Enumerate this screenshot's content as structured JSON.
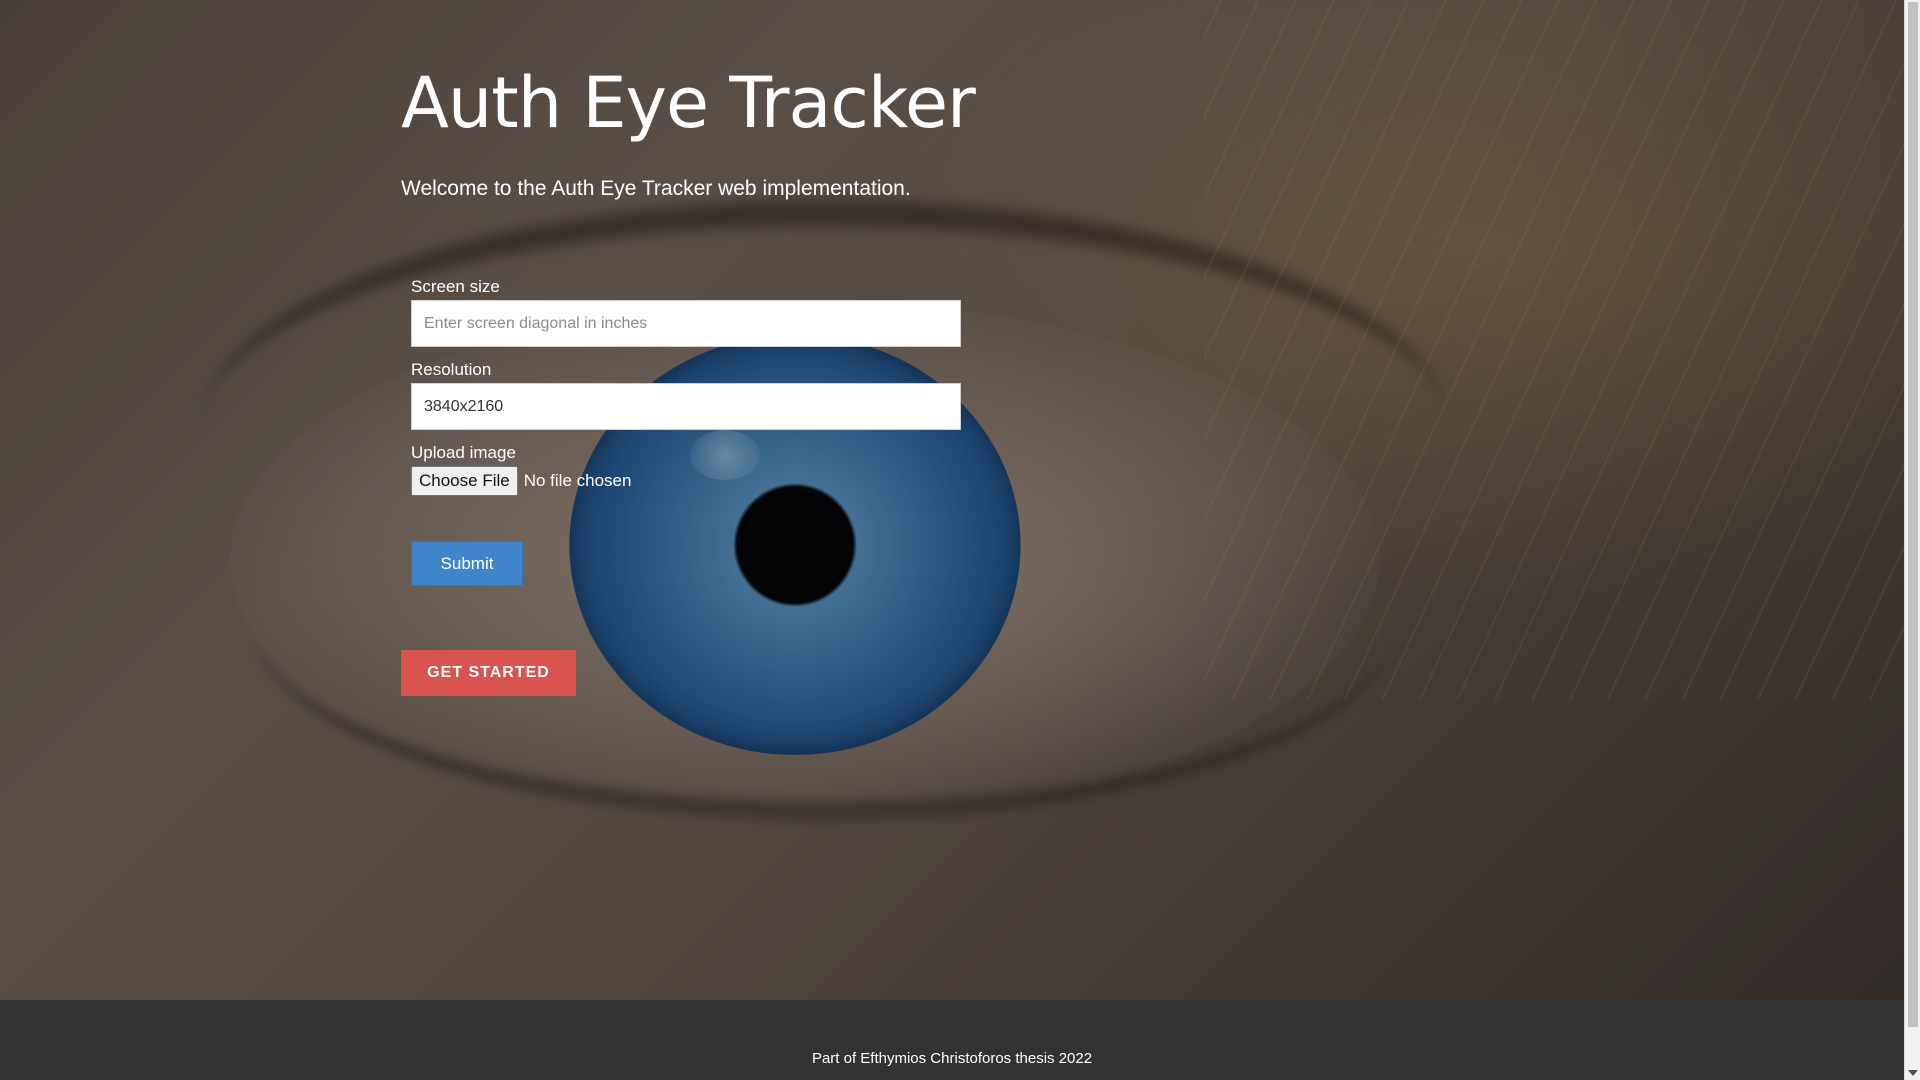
{
  "header": {
    "title": "Auth Eye Tracker",
    "subtitle": "Welcome to the Auth Eye Tracker web implementation."
  },
  "form": {
    "screen_size": {
      "label": "Screen size",
      "placeholder": "Enter screen diagonal in inches",
      "value": ""
    },
    "resolution": {
      "label": "Resolution",
      "value": "3840x2160"
    },
    "upload": {
      "label": "Upload image",
      "button_label": "Choose File",
      "status": "No file chosen"
    },
    "submit_label": "Submit"
  },
  "cta": {
    "get_started_label": "GET STARTED"
  },
  "footer": {
    "text": "Part of Efthymios Christoforos thesis 2022"
  },
  "colors": {
    "submit": "#3e85cc",
    "get_started": "#d9534f",
    "footer_bg": "#333333"
  },
  "icons": {
    "scroll_down": "chevron-down-icon"
  }
}
